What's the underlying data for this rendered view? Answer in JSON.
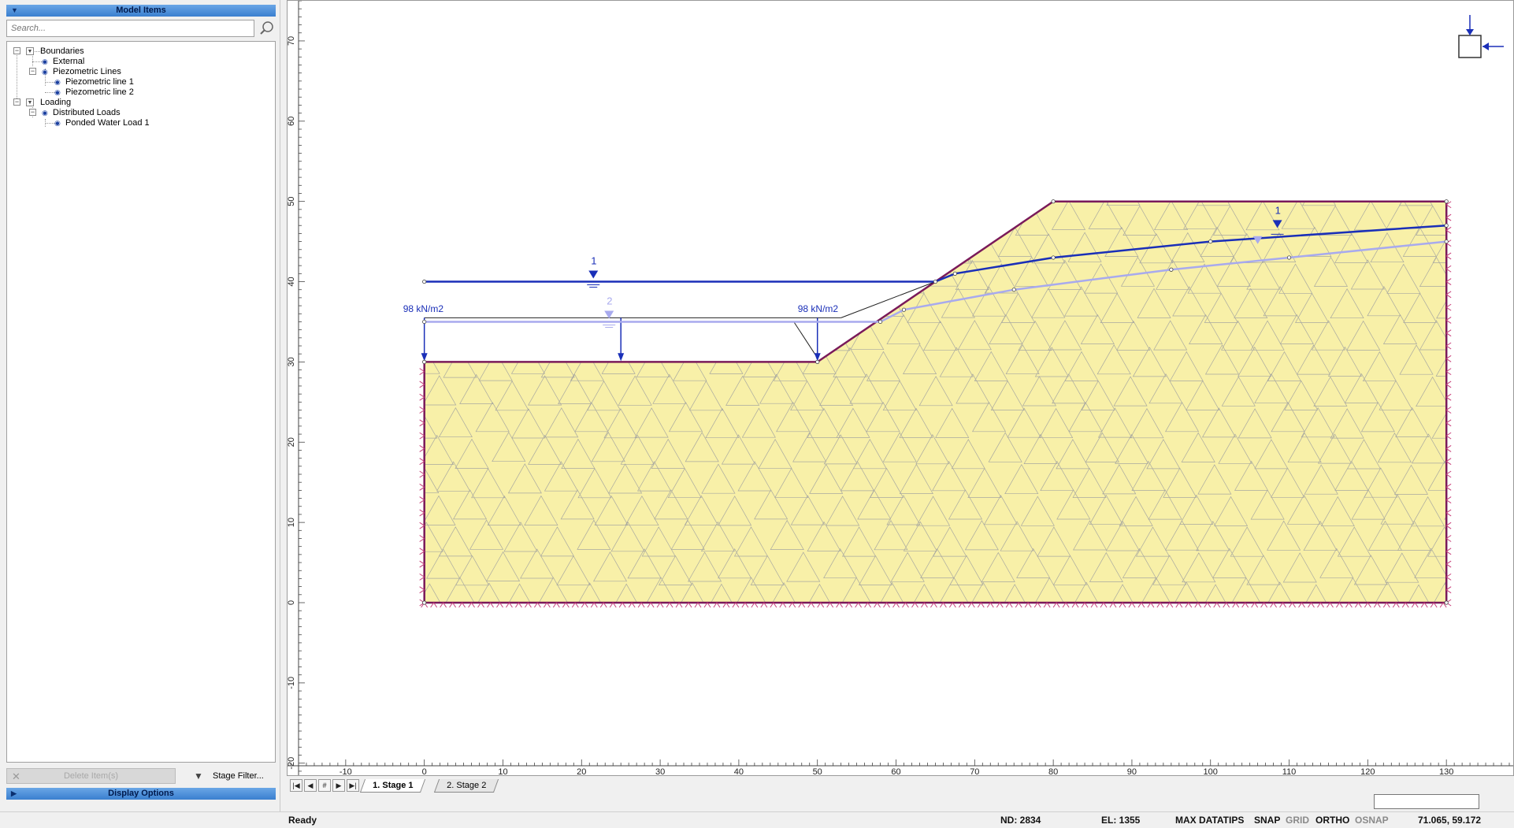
{
  "model_items": {
    "title": "Model Items",
    "search_placeholder": "Search...",
    "tree": {
      "boundaries": "Boundaries",
      "external": "External",
      "piezometric_lines": "Piezometric Lines",
      "piezo_line_1": "Piezometric line 1",
      "piezo_line_2": "Piezometric line 2",
      "loading": "Loading",
      "distributed_loads": "Distributed Loads",
      "ponded_water_load_1": "Ponded Water Load 1"
    },
    "delete_label": "Delete Item(s)",
    "stage_filter_label": "Stage Filter..."
  },
  "display_options": {
    "title": "Display Options"
  },
  "stages": {
    "tabs": [
      "1. Stage 1",
      "2. Stage 2"
    ],
    "active_index": 0,
    "nav": [
      "first",
      "prev",
      "#",
      "next",
      "last"
    ]
  },
  "canvas": {
    "x_ticks": [
      -10,
      0,
      10,
      20,
      30,
      40,
      50,
      60,
      70,
      80,
      90,
      100,
      110,
      120,
      130
    ],
    "y_ticks": [
      70,
      60,
      50,
      40,
      30,
      20,
      10,
      0,
      -10,
      -20
    ],
    "x_range": [
      -17.4,
      138.5
    ],
    "y_range": [
      -21.5,
      75
    ],
    "soil_polygon": [
      [
        0,
        0
      ],
      [
        0,
        30
      ],
      [
        50,
        30
      ],
      [
        80,
        50
      ],
      [
        130,
        50
      ],
      [
        130,
        0
      ]
    ],
    "piezo_line_1": [
      [
        0,
        40
      ],
      [
        65,
        40
      ],
      [
        67.5,
        41
      ],
      [
        80,
        43
      ],
      [
        100,
        45
      ],
      [
        130,
        47
      ]
    ],
    "piezo_line_2": [
      [
        0,
        35
      ],
      [
        58,
        35
      ],
      [
        61,
        36.5
      ],
      [
        75,
        39
      ],
      [
        95,
        41.5
      ],
      [
        110,
        43
      ],
      [
        130,
        45
      ]
    ],
    "piezo_labels": [
      "1",
      "2",
      "1"
    ],
    "load_label_left": "98 kN/m2",
    "load_label_right": "98 kN/m2",
    "colors": {
      "soil_fill": "#f8f0a8",
      "mesh": "#a8a8a0",
      "boundary": "#7a1a5a",
      "piezo_1": "#1a2fb8",
      "piezo_2": "#a8aaee",
      "load": "#1a2fb8",
      "support": "#c8407a"
    }
  },
  "status": {
    "ready": "Ready",
    "nd": "ND: 2834",
    "el": "EL: 1355",
    "max_datatips": "MAX DATATIPS",
    "snap": "SNAP",
    "grid": "GRID",
    "ortho": "ORTHO",
    "osnap": "OSNAP",
    "coords": "71.065,  59.172"
  }
}
